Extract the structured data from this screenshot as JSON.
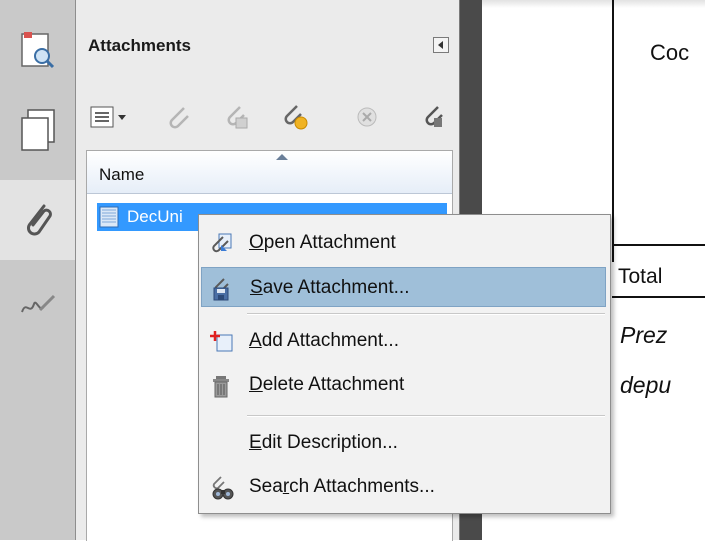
{
  "panel": {
    "title": "Attachments",
    "column_header": "Name",
    "selected_file": "DecUni"
  },
  "document": {
    "text_top": "Coc",
    "text_total": "Total",
    "text_italic_1": "Prez",
    "text_italic_2": "depu"
  },
  "context_menu": {
    "items": [
      {
        "label": "Open Attachment",
        "mnemonic": "O",
        "rest": "pen Attachment",
        "icon": "open-attachment-icon"
      },
      {
        "label": "Save Attachment...",
        "mnemonic": "S",
        "rest": "ave Attachment...",
        "icon": "save-attachment-icon",
        "highlighted": true
      },
      {
        "label": "Add Attachment...",
        "mnemonic": "A",
        "rest": "dd Attachment...",
        "icon": "add-attachment-icon"
      },
      {
        "label": "Delete Attachment",
        "mnemonic": "D",
        "rest": "elete Attachment",
        "icon": "trash-icon"
      },
      {
        "label": "Edit Description...",
        "mnemonic": "E",
        "rest": "dit Description..."
      },
      {
        "label": "Search Attachments...",
        "pre": "Sea",
        "mnemonic": "r",
        "rest": "ch Attachments...",
        "icon": "binoculars-icon"
      }
    ]
  },
  "colors": {
    "selection": "#3399ff",
    "menu_hover": "#9fbfd9",
    "panel_bg": "#ebebeb",
    "rail_bg": "#c9c9c9"
  }
}
